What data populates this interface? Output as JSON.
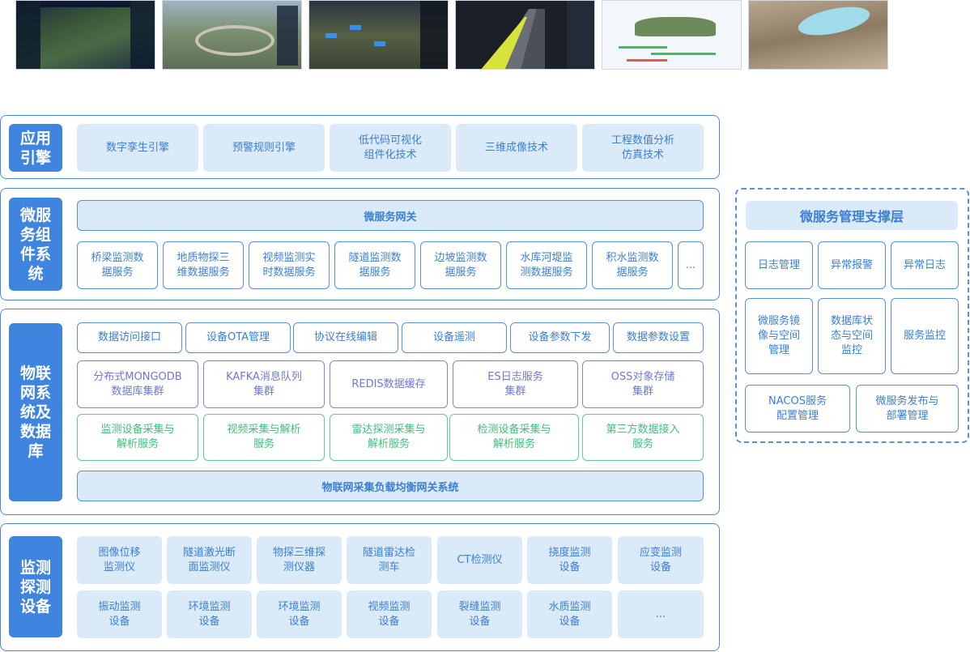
{
  "screenshots": [
    {
      "name": "screenshot-map-dashboard"
    },
    {
      "name": "screenshot-3d-interchange"
    },
    {
      "name": "screenshot-video-monitoring"
    },
    {
      "name": "screenshot-tunnel-3d"
    },
    {
      "name": "screenshot-terrain-gantt"
    },
    {
      "name": "screenshot-reservoir-3d"
    }
  ],
  "layers": {
    "app_engine": {
      "label": "应用\n引擎",
      "items": [
        "数字孪生引擎",
        "预警规则引擎",
        "低代码可视化\n组件化技术",
        "三维成像技术",
        "工程数值分析\n仿真技术"
      ]
    },
    "microservice": {
      "label": "微服\n务组\n件系\n统",
      "gateway": "微服务网关",
      "items": [
        "桥梁监测数\n据服务",
        "地质物探三\n维数据服务",
        "视频监测实\n时数据服务",
        "隧道监测数\n据服务",
        "边坡监测数\n据服务",
        "水库河堤监\n测数据服务",
        "积水监测数\n据服务",
        "..."
      ]
    },
    "iot": {
      "label": "物联\n网系\n统及\n数据\n库",
      "row1": [
        "数据访问接口",
        "设备OTA管理",
        "协议在线编辑",
        "设备遥测",
        "设备参数下发",
        "数据参数设置"
      ],
      "row2": [
        "分布式MONGODB\n数据库集群",
        "KAFKA消息队列\n集群",
        "REDIS数据缓存",
        "ES日志服务\n集群",
        "OSS对象存储\n集群"
      ],
      "row3": [
        "监测设备采集与\n解析服务",
        "视频采集与解析\n服务",
        "雷达探测采集与\n解析服务",
        "检测设备采集与\n解析服务",
        "第三方数据接入\n服务"
      ],
      "gateway": "物联网采集负载均衡网关系统"
    },
    "devices": {
      "label": "监测\n探测\n设备",
      "row1": [
        "图像位移\n监测仪",
        "隧道激光断\n面监测仪",
        "物探三维探\n测仪器",
        "隧道雷达检\n测车",
        "CT检测仪",
        "挠度监测\n设备",
        "应变监测\n设备"
      ],
      "row2": [
        "振动监测\n设备",
        "环境监测\n设备",
        "环境监测\n设备",
        "视频监测\n设备",
        "裂缝监测\n设备",
        "水质监测\n设备",
        "..."
      ]
    }
  },
  "management": {
    "title": "微服务管理支撑层",
    "row1": [
      "日志管理",
      "异常报警",
      "异常日志"
    ],
    "row2": [
      "微服务镜\n像与空间\n管理",
      "数据库状\n态与空间\n监控",
      "服务监控"
    ],
    "row3": [
      "NACOS服务\n配置管理",
      "微服务发布与\n部署管理"
    ]
  },
  "colors": {
    "primary_blue": "#3f84de",
    "light_blue": "#dbeaf9",
    "border_blue": "#4f86dd",
    "purple": "#6d79d9",
    "green": "#3fbf7a"
  }
}
